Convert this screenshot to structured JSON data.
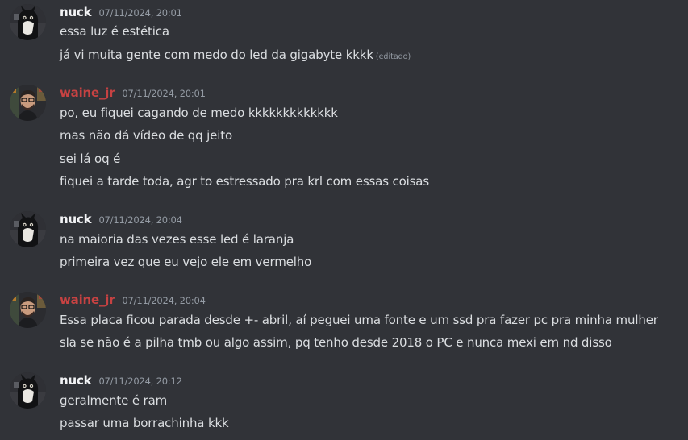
{
  "colors": {
    "background": "#313338",
    "text": "#dbdee1",
    "muted": "#949ba4",
    "nuck_name": "#f2f3f5",
    "waine_name": "#c64242"
  },
  "messages": [
    {
      "author": "nuck",
      "avatar_icon": "cat-avatar-icon",
      "timestamp": "07/11/2024, 20:01",
      "lines": [
        "essa luz é estética",
        "já vi muita gente com medo do led da gigabyte kkkk"
      ],
      "edited_label": "(editado)"
    },
    {
      "author": "waine_jr",
      "avatar_icon": "person-glasses-avatar-icon",
      "timestamp": "07/11/2024, 20:01",
      "lines": [
        "po, eu fiquei cagando de medo kkkkkkkkkkkkk",
        "mas não dá vídeo de qq jeito",
        "sei lá oq é",
        "fiquei a tarde toda, agr to estressado pra krl com essas coisas"
      ]
    },
    {
      "author": "nuck",
      "avatar_icon": "cat-avatar-icon",
      "timestamp": "07/11/2024, 20:04",
      "lines": [
        "na maioria das vezes esse led é laranja",
        "primeira vez que eu vejo ele em vermelho"
      ]
    },
    {
      "author": "waine_jr",
      "avatar_icon": "person-glasses-avatar-icon",
      "timestamp": "07/11/2024, 20:04",
      "lines": [
        "Essa placa ficou parada desde +- abril, aí peguei uma fonte e um ssd pra fazer pc pra minha mulher",
        "sla se não é a pilha tmb ou algo assim, pq tenho desde 2018 o PC e nunca mexi em nd disso"
      ]
    },
    {
      "author": "nuck",
      "avatar_icon": "cat-avatar-icon",
      "timestamp": "07/11/2024, 20:12",
      "lines": [
        "geralmente é ram",
        "passar uma borrachinha kkk"
      ]
    }
  ]
}
